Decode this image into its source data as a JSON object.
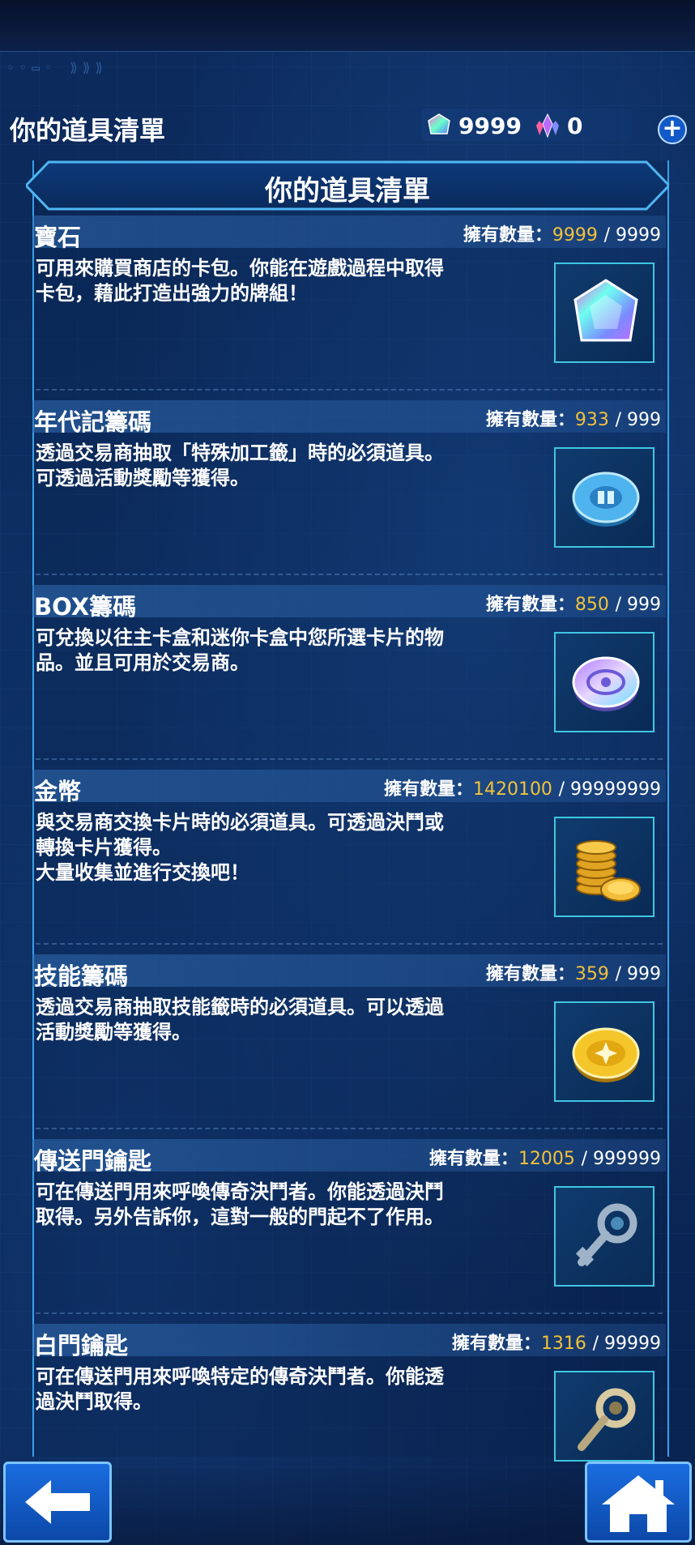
{
  "header": {
    "title": "你的道具清單",
    "gems": "9999",
    "premium": "0"
  },
  "panel": {
    "title": "你的道具清單"
  },
  "count_label": "擁有數量：",
  "items": [
    {
      "name": "寶石",
      "current": "9999",
      "max": "/ 9999",
      "desc": "可用來購買商店的卡包。你能在遊戲過程中取得\n卡包，藉此打造出強力的牌組！",
      "icon": "gem-icon"
    },
    {
      "name": "年代記籌碼",
      "current": "933",
      "max": "/ 999",
      "desc": "透過交易商抽取「特殊加工籤」時的必須道具。\n可透過活動獎勵等獲得。",
      "icon": "chronicle-chip-icon"
    },
    {
      "name": "BOX籌碼",
      "current": "850",
      "max": "/ 999",
      "desc": "可兌換以往主卡盒和迷你卡盒中您所選卡片的物\n品。並且可用於交易商。",
      "icon": "box-chip-icon"
    },
    {
      "name": "金幣",
      "current": "1420100",
      "max": "/ 99999999",
      "desc": "與交易商交換卡片時的必須道具。可透過決鬥或\n轉換卡片獲得。\n大量收集並進行交換吧！",
      "icon": "gold-coins-icon"
    },
    {
      "name": "技能籌碼",
      "current": "359",
      "max": "/ 999",
      "desc": "透過交易商抽取技能籤時的必須道具。可以透過\n活動獎勵等獲得。",
      "icon": "skill-chip-icon"
    },
    {
      "name": "傳送門鑰匙",
      "current": "12005",
      "max": "/ 999999",
      "desc": "可在傳送門用來呼喚傳奇決鬥者。你能透過決鬥\n取得。另外告訴你，這對一般的門起不了作用。",
      "icon": "gate-key-icon"
    },
    {
      "name": "白門鑰匙",
      "current": "1316",
      "max": "/ 99999",
      "desc": "可在傳送門用來呼喚特定的傳奇決鬥者。你能透\n過決鬥取得。",
      "icon": "white-gate-key-icon"
    }
  ],
  "colors": {
    "accent": "#3fc7e0",
    "count": "#f2c23a",
    "button": "#1a6de0"
  }
}
